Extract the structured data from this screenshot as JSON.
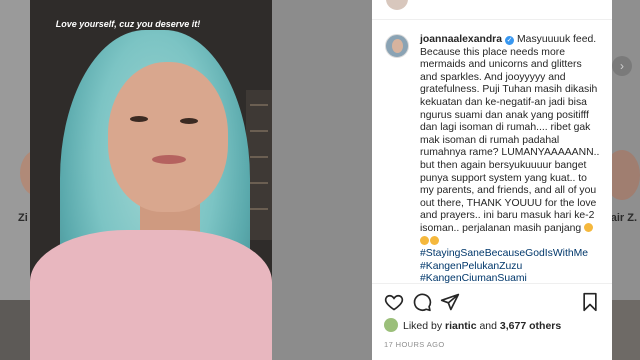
{
  "photo": {
    "overlay_text": "Love yourself, cuz you deserve it!"
  },
  "background": {
    "left_name": "Zi",
    "right_name": "dair Z."
  },
  "post": {
    "username": "joannaalexandra",
    "caption": "Masyuuuuk feed. Because this place needs more mermaids and unicorns and glitters and sparkles. And jooyyyyy and gratefulness. Puji Tuhan masih dikasih kekuatan dan ke-negatif-an jadi bisa ngurus suami dan anak yang positifff dan lagi isoman di rumah.... ribet gak mak isoman di rumah padahal rumahnya rame? LUMANYAAAAANN.. but then again bersyukuuuur banget punya support system yang kuat.. to my parents, and friends, and all of you out there, THANK YOUUU for the love and prayers.. ini baru masuk hari ke-2 isoman.. perjalanan masih panjang",
    "hashtags": [
      "#StayingSaneBecauseGodIsWithMe",
      "#KangenPelukanZuzu",
      "#KangenCiumanSuami"
    ],
    "likes_prefix": "Liked by",
    "liked_by_user": "riantic",
    "likes_conjunction": "and",
    "likes_count": "3,677 others",
    "timestamp": "17 HOURS AGO"
  },
  "icons": {
    "like": "heart-icon",
    "comment": "comment-icon",
    "share": "send-icon",
    "save": "bookmark-icon",
    "verified": "verified-badge-icon",
    "next": "chevron-right-icon"
  },
  "colors": {
    "hashtag": "#00376b",
    "verified": "#3897f0",
    "timestamp": "#8e8e8e"
  }
}
